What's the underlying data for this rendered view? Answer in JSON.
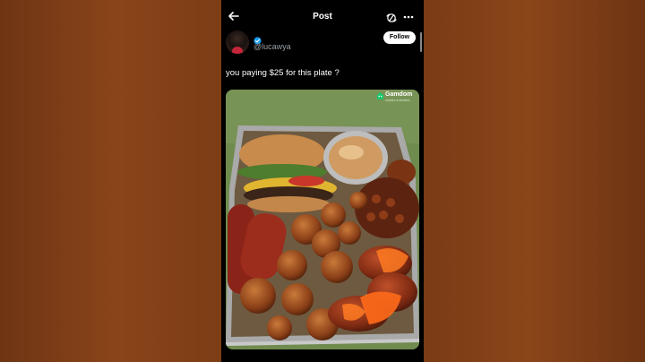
{
  "header": {
    "title": "Post"
  },
  "post": {
    "handle": "@lucawya",
    "follow_label": "Follow",
    "text": "you paying $25 for this plate ?"
  },
  "media": {
    "watermark": "Gamdom",
    "watermark_sub": "CASINO & SPORTS"
  },
  "colors": {
    "background": "#7a3b15",
    "verified": "#1d9bf0",
    "watermark": "#18c76b"
  },
  "icons": [
    "back-arrow-icon",
    "sync-icon",
    "more-icon",
    "verified-icon",
    "watermark-logo-icon"
  ]
}
